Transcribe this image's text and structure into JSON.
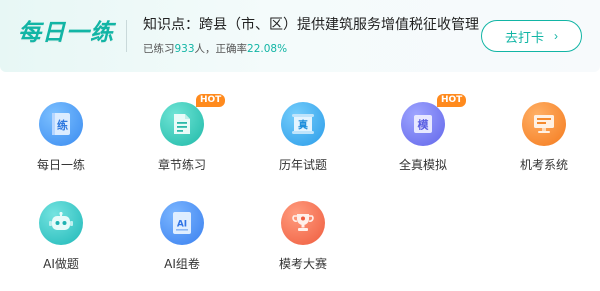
{
  "banner": {
    "logo_text": "每日一练",
    "knowledge_point": "知识点：跨县（市、区）提供建筑服务增值税征收管理",
    "stats_prefix": "已练习",
    "stats_count": "933",
    "stats_mid": "人，正确率",
    "stats_rate": "22.08%",
    "go_button_label": "去打卡",
    "go_button_chevron": "›"
  },
  "features": [
    {
      "label": "每日一练",
      "icon": "daily-practice-icon",
      "glyph": "练",
      "hot": false
    },
    {
      "label": "章节练习",
      "icon": "chapter-document-icon",
      "glyph": "",
      "hot": true,
      "hot_label": "HOT"
    },
    {
      "label": "历年试题",
      "icon": "past-exam-scroll-icon",
      "glyph": "真",
      "hot": false
    },
    {
      "label": "全真模拟",
      "icon": "mock-exam-icon",
      "glyph": "模",
      "hot": true,
      "hot_label": "HOT"
    },
    {
      "label": "机考系统",
      "icon": "computer-exam-icon",
      "glyph": "",
      "hot": false
    },
    {
      "label": "AI做题",
      "icon": "robot-icon",
      "glyph": "",
      "hot": false
    },
    {
      "label": "AI组卷",
      "icon": "ai-paper-icon",
      "glyph": "AI",
      "hot": false
    },
    {
      "label": "模考大赛",
      "icon": "trophy-icon",
      "glyph": "",
      "hot": false
    }
  ],
  "colors": {
    "accent": "#12b5a5",
    "hot_badge": "#ff8a1d"
  }
}
